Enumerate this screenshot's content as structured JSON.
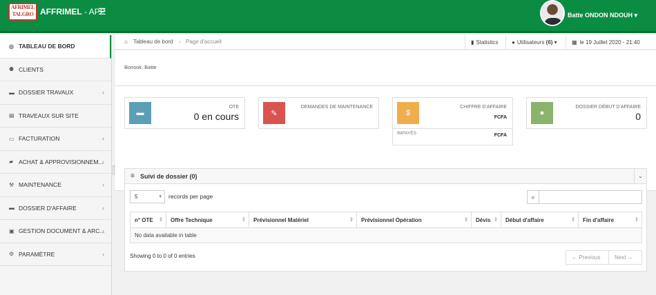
{
  "app": {
    "logo_top": "AFRIMEL",
    "logo_bottom": "TALGRO",
    "brand_name": "AFFRIMEL",
    "brand_suffix": " - APP",
    "user_name": "Batte ONDON NDOUH",
    "brand_color": "#0a8c43"
  },
  "sidebar": {
    "items": [
      {
        "label": "TABLEAU DE BORD",
        "icon": "dashboard-icon",
        "glyph": "◎",
        "chevron": false,
        "active": true
      },
      {
        "label": "CLIENTS",
        "icon": "users-icon",
        "glyph": "⚉",
        "chevron": false
      },
      {
        "label": "DOSSIER TRAVAUX",
        "icon": "folder-icon",
        "glyph": "▬",
        "chevron": true
      },
      {
        "label": "TRAVEAUX SUR SITE",
        "icon": "file-icon",
        "glyph": "▤",
        "chevron": false
      },
      {
        "label": "FACTURATION",
        "icon": "credit-card-icon",
        "glyph": "▭",
        "chevron": true
      },
      {
        "label": "ACHAT & APPROVISIONNEM...",
        "icon": "truck-icon",
        "glyph": "▰",
        "chevron": true
      },
      {
        "label": "MAINTENANCE",
        "icon": "wrench-icon",
        "glyph": "⚒",
        "chevron": true
      },
      {
        "label": "DOSSIER D'AFFAIRE",
        "icon": "folder-open-icon",
        "glyph": "▬",
        "chevron": true
      },
      {
        "label": "GESTION DOCUMENT & ARC...",
        "icon": "archive-icon",
        "glyph": "▣",
        "chevron": true
      },
      {
        "label": "PARAMÈTRE",
        "icon": "cogs-icon",
        "glyph": "⚙",
        "chevron": true
      }
    ]
  },
  "breadcrumb": {
    "home": "Tableau de bord",
    "current": "Page d'accueil",
    "statistics": "Statistics",
    "users_label": "Utilisateurs",
    "users_count": "(6)",
    "date": "le 19 Juillet 2020 - 21:40"
  },
  "greeting": "Bonsoir, Batte",
  "cards": {
    "ote": {
      "label": "OTE",
      "value": "0 en cours",
      "color": "#5b9fb7"
    },
    "maintenance": {
      "label": "DEMANDES DE MAINTENANCE",
      "color": "#d9534f"
    },
    "chiffre": {
      "label": "CHIFFRE D'AFFAIRE",
      "value": "FCFA",
      "sub_label": "IMPAYÉS",
      "sub_value": "FCFA",
      "icon_glyph": "$",
      "color": "#f0ad4e"
    },
    "dossier": {
      "label": "DOSSIER DÉBUT D'AFFAIRE",
      "value": "0",
      "color": "#8cb36b"
    }
  },
  "panel": {
    "title": "Suivi de dossier (0)",
    "page_size": "5",
    "records_label": "records per page",
    "columns": [
      "n° OTE",
      "Offre Technique",
      "Prévisionnel Matériel",
      "Prévisionnel Opération",
      "Dévis",
      "Début d'affaire",
      "Fin d'affaire"
    ],
    "empty_text": "No data available in table",
    "showing": "Showing 0 to 0 of 0 entries",
    "previous": "← Previous",
    "next": "Next →"
  }
}
